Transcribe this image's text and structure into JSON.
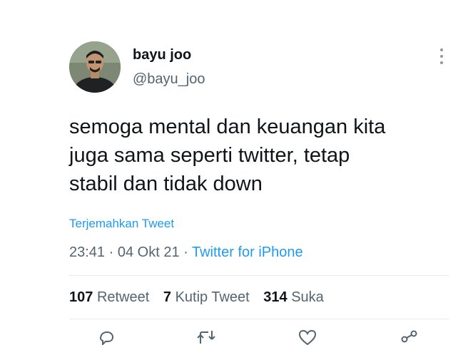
{
  "user": {
    "display_name": "bayu joo",
    "handle": "@bayu_joo"
  },
  "tweet": {
    "lines": [
      "semoga mental dan keuangan kita",
      "juga sama seperti twitter, tetap",
      "stabil dan tidak down"
    ],
    "translate_label": "Terjemahkan Tweet"
  },
  "meta": {
    "time": "23:41",
    "date": "04 Okt 21",
    "separator": " · ",
    "source": "Twitter for iPhone"
  },
  "stats": {
    "retweets_count": "107",
    "retweets_label": "Retweet",
    "quotes_count": "7",
    "quotes_label": "Kutip Tweet",
    "likes_count": "314",
    "likes_label": "Suka"
  },
  "colors": {
    "link": "#1d9bf0",
    "secondary_text": "#536471",
    "primary_text": "#0f1419"
  },
  "icons": {
    "more": "more-vertical-icon",
    "reply": "reply-icon",
    "retweet": "retweet-icon",
    "like": "heart-icon",
    "share": "share-icon"
  }
}
